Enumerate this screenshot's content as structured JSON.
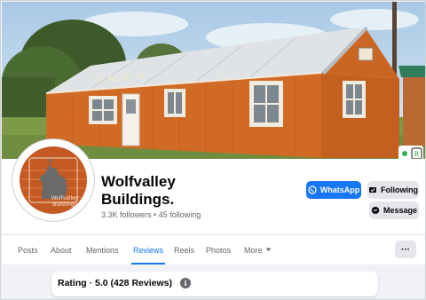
{
  "page": {
    "name_line1": "Wolfvalley",
    "name_line2": "Buildings.",
    "stats": "3.3K followers • 45 following",
    "avatar_text_line1": "Wolfvalley",
    "avatar_text_line2": "Buildings"
  },
  "actions": {
    "whatsapp_label": "WhatsApp",
    "following_label": "Following",
    "message_label": "Message"
  },
  "tabs": [
    {
      "label": "Posts"
    },
    {
      "label": "About"
    },
    {
      "label": "Mentions"
    },
    {
      "label": "Reviews",
      "active": true
    },
    {
      "label": "Reels"
    },
    {
      "label": "Photos"
    },
    {
      "label": "More"
    }
  ],
  "more_dots": "···",
  "reviews": {
    "rating_text": "Rating · 5.0 (428 Reviews)",
    "info_glyph": "i"
  },
  "colors": {
    "accent": "#1877f2",
    "building_orange": "#d06a25",
    "roof": "#d9dde0",
    "sky": "#b8d4ec"
  },
  "icons": [
    "whatsapp-icon",
    "following-icon",
    "messenger-icon",
    "chevron-down-icon",
    "more-icon",
    "info-icon"
  ]
}
